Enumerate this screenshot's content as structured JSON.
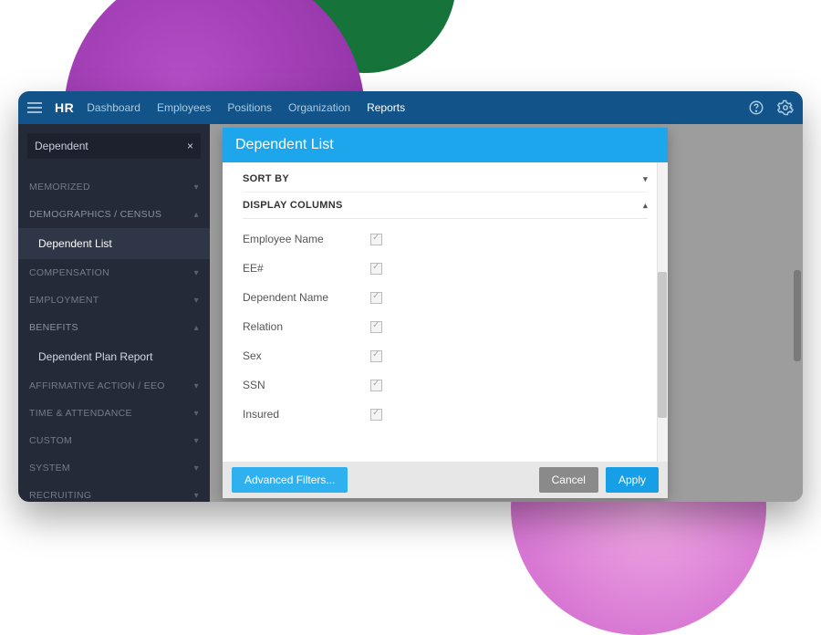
{
  "brand": "HR",
  "nav": {
    "items": [
      "Dashboard",
      "Employees",
      "Positions",
      "Organization",
      "Reports"
    ],
    "active_index": 4
  },
  "sidebar": {
    "search_value": "Dependent",
    "groups": [
      {
        "label": "MEMORIZED",
        "expanded": false
      },
      {
        "label": "DEMOGRAPHICS / CENSUS",
        "expanded": true,
        "items": [
          {
            "label": "Dependent List",
            "selected": true
          }
        ]
      },
      {
        "label": "COMPENSATION",
        "expanded": false
      },
      {
        "label": "EMPLOYMENT",
        "expanded": false
      },
      {
        "label": "BENEFITS",
        "expanded": true,
        "items": [
          {
            "label": "Dependent Plan Report",
            "selected": false
          }
        ]
      },
      {
        "label": "AFFIRMATIVE ACTION / EEO",
        "expanded": false
      },
      {
        "label": "TIME & ATTENDANCE",
        "expanded": false
      },
      {
        "label": "CUSTOM",
        "expanded": false
      },
      {
        "label": "SYSTEM",
        "expanded": false
      },
      {
        "label": "RECRUITING",
        "expanded": false
      }
    ]
  },
  "dialog": {
    "title": "Dependent List",
    "sections": {
      "sort_by": "SORT BY",
      "display_columns": "DISPLAY COLUMNS"
    },
    "columns": [
      {
        "label": "Employee Name",
        "checked": true
      },
      {
        "label": "EE#",
        "checked": true
      },
      {
        "label": "Dependent Name",
        "checked": true
      },
      {
        "label": "Relation",
        "checked": true
      },
      {
        "label": "Sex",
        "checked": true
      },
      {
        "label": "SSN",
        "checked": true
      },
      {
        "label": "Insured",
        "checked": true
      }
    ],
    "buttons": {
      "advanced": "Advanced Filters...",
      "cancel": "Cancel",
      "apply": "Apply"
    }
  },
  "colors": {
    "topbar": "#12538a",
    "accent": "#1ea6ec",
    "sidebar_bg": "#252a38"
  }
}
